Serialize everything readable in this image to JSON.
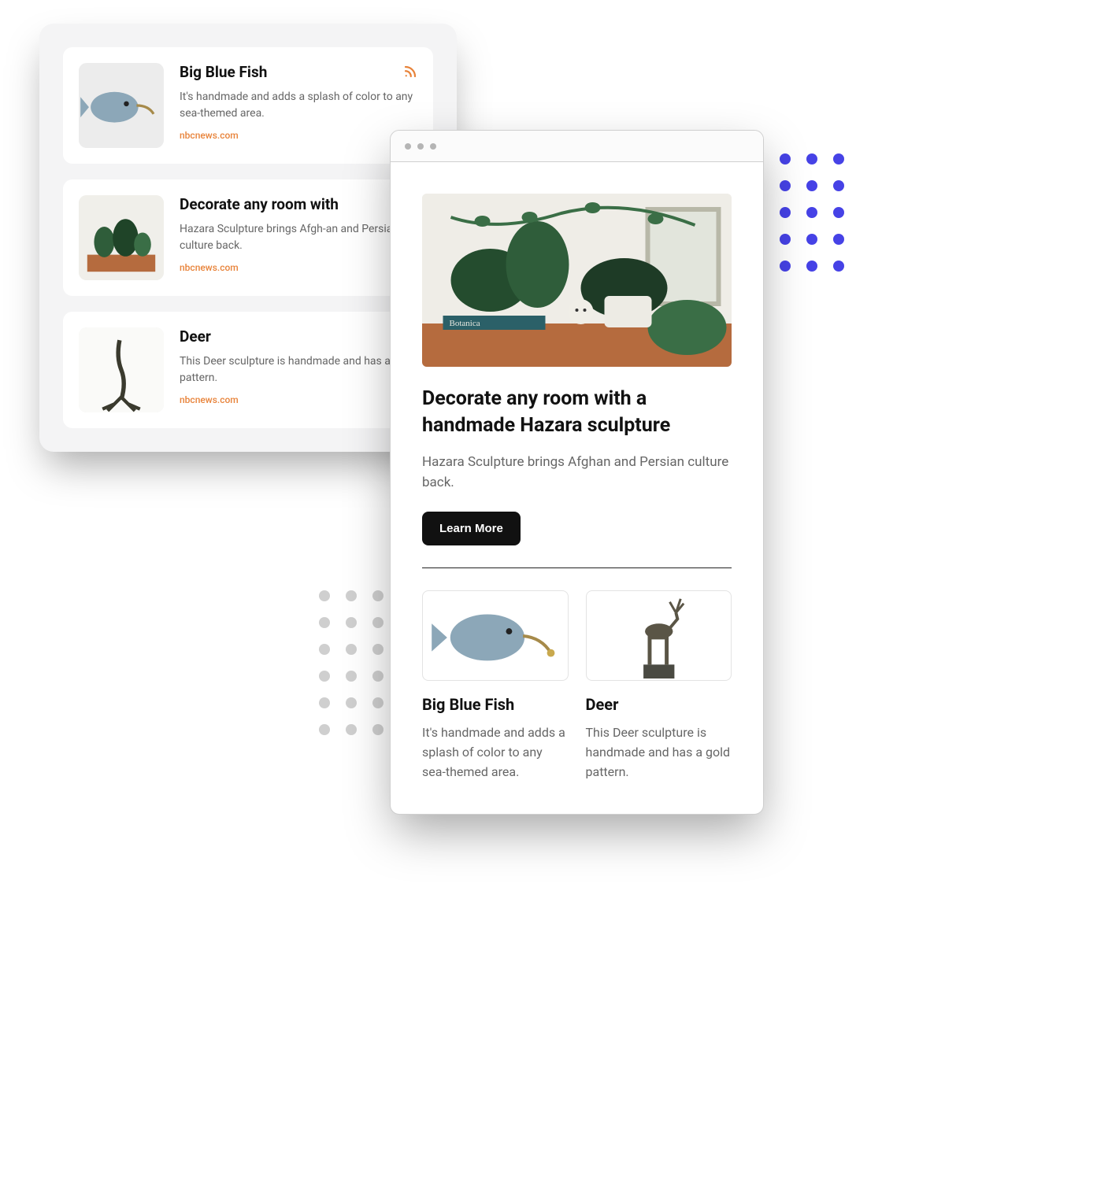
{
  "list": {
    "items": [
      {
        "title": "Big Blue Fish",
        "desc": "It's handmade and adds a splash of color to any sea-themed area.",
        "source": "nbcnews.com",
        "icon": "fish",
        "has_rss": true
      },
      {
        "title": "Decorate any room with",
        "desc": "Hazara Sculpture brings Afgh-an and Persian culture back.",
        "source": "nbcnews.com",
        "icon": "plants",
        "has_rss": false
      },
      {
        "title": "Deer",
        "desc": "This Deer sculpture is handmade and has a gold pattern.",
        "source": "nbcnews.com",
        "icon": "deer",
        "has_rss": false
      }
    ]
  },
  "browser": {
    "hero": {
      "title": "Decorate any room with a handmade Hazara sculpture",
      "desc": "Hazara Sculpture brings Afghan and Persian culture back.",
      "cta": "Learn More"
    },
    "products": [
      {
        "title": "Big Blue Fish",
        "desc": "It's handmade and adds a splash of color to any sea-themed area.",
        "icon": "fish"
      },
      {
        "title": "Deer",
        "desc": "This Deer sculpture is handmade and has a gold pattern.",
        "icon": "deer"
      }
    ]
  }
}
